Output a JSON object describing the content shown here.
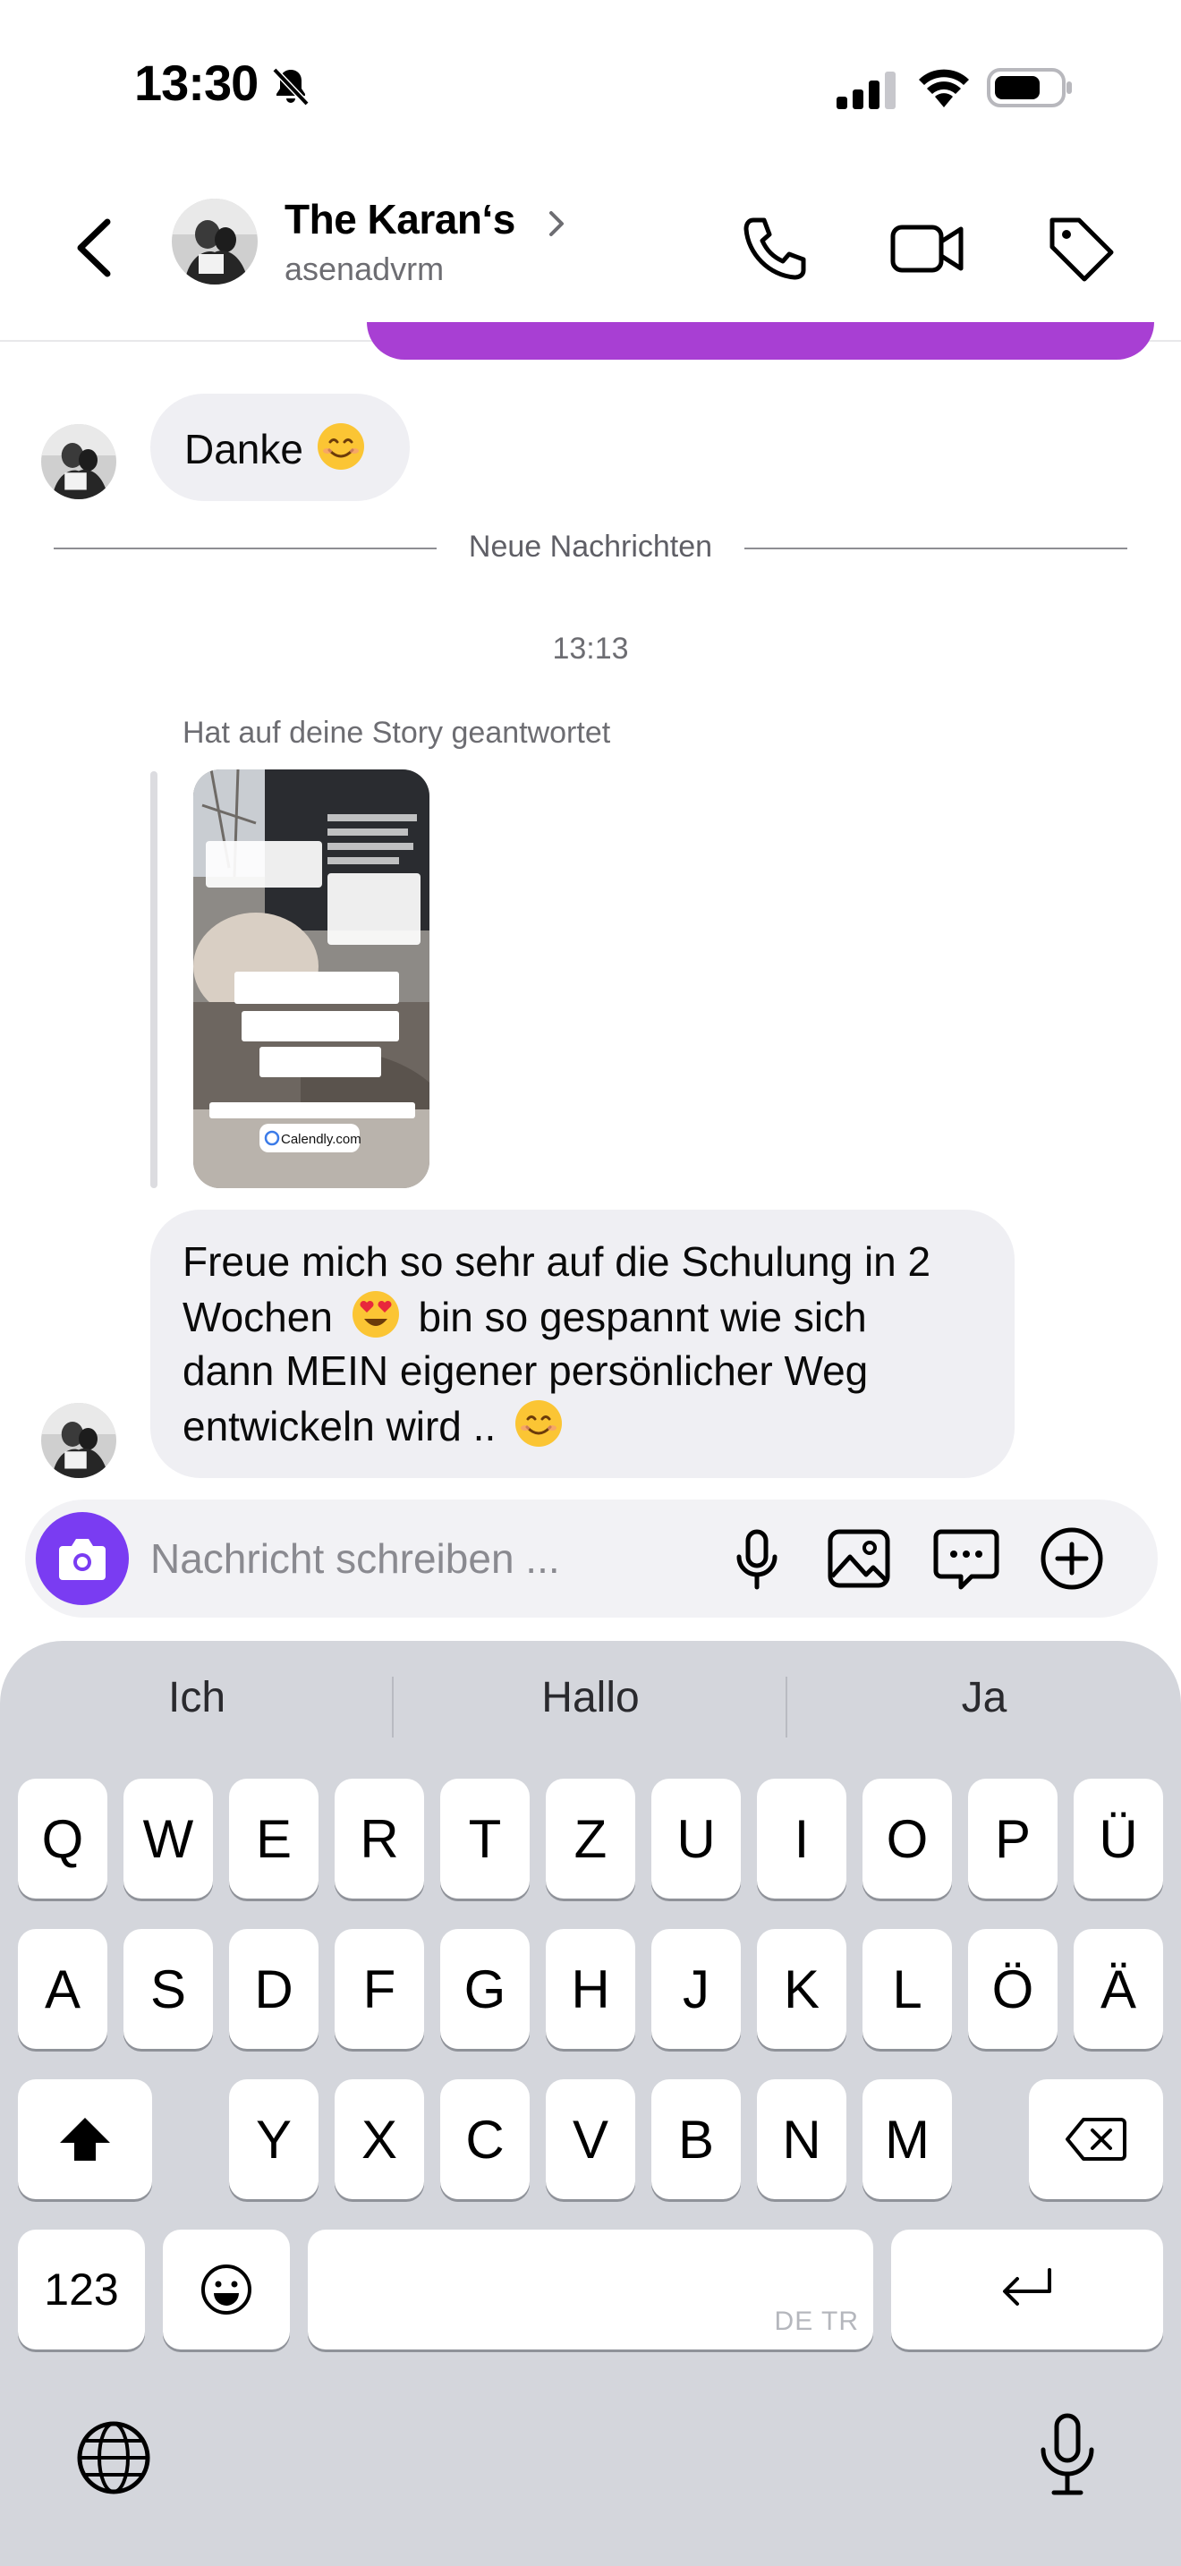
{
  "status_bar": {
    "time": "13:30",
    "icons": [
      "bell-slash-icon",
      "cellular-signal-icon",
      "wifi-icon",
      "battery-icon"
    ]
  },
  "header": {
    "contact_name": "The Karan‘s",
    "handle": "asenadvrm",
    "icons": [
      "back-chevron-icon",
      "chevron-right-icon",
      "phone-icon",
      "video-camera-icon",
      "tag-icon"
    ]
  },
  "chat": {
    "messages": [
      {
        "type": "text",
        "sender": "contact",
        "text": "Danke",
        "emoji": "smiling-face-emoji"
      },
      {
        "type": "divider",
        "text": "Neue Nachrichten"
      },
      {
        "type": "timestamp",
        "text": "13:13"
      },
      {
        "type": "story_reply",
        "label": "Hat auf deine Story geantwortet",
        "story_link": "Calendly.com"
      },
      {
        "type": "text",
        "sender": "contact",
        "lines": [
          "Freue mich so sehr auf die Schulung in 2",
          "Wochen",
          "bin so gespannt wie sich",
          "dann MEIN eigener persönlicher Weg",
          "entwickeln wird .."
        ],
        "emojis": [
          "heart-eyes-emoji",
          "smiling-face-emoji"
        ]
      }
    ]
  },
  "composer": {
    "placeholder": "Nachricht schreiben ...",
    "value": "",
    "icons": [
      "camera-icon",
      "microphone-icon",
      "image-icon",
      "sticker-chat-icon",
      "plus-circle-icon"
    ],
    "accent_color": "#7a3cf2"
  },
  "keyboard": {
    "suggestions": [
      "Ich",
      "Hallo",
      "Ja"
    ],
    "row1": [
      "Q",
      "W",
      "E",
      "R",
      "T",
      "Z",
      "U",
      "I",
      "O",
      "P",
      "Ü"
    ],
    "row2": [
      "A",
      "S",
      "D",
      "F",
      "G",
      "H",
      "J",
      "K",
      "L",
      "Ö",
      "Ä"
    ],
    "row3": [
      "Y",
      "X",
      "C",
      "V",
      "B",
      "N",
      "M"
    ],
    "numbers_key": "123",
    "space_label": "DE TR",
    "icons": [
      "shift-icon",
      "delete-icon",
      "emoji-icon",
      "return-icon",
      "globe-icon",
      "dictation-microphone-icon"
    ]
  }
}
